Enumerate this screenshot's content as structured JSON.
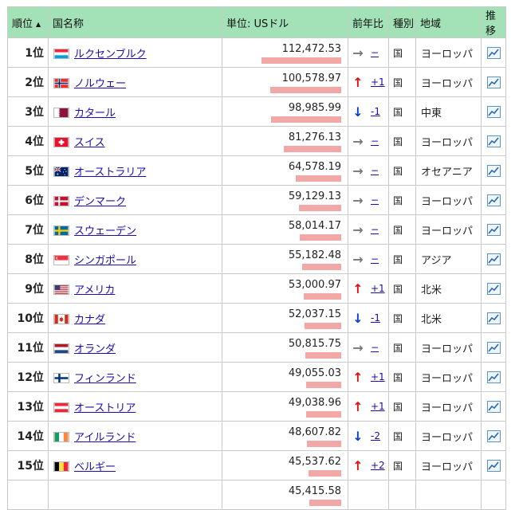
{
  "headers": {
    "rank": "順位",
    "sort_marker": "▲",
    "country": "国名称",
    "unit": "単位: USドル",
    "change": "前年比",
    "type": "種別",
    "region": "地域",
    "trend": "推移"
  },
  "rows": [
    {
      "rank": "1位",
      "country": "ルクセンブルク",
      "flag": "luxembourg",
      "value": "112,472.53",
      "bar": 1.0,
      "dir": "same",
      "arrow": "→",
      "change": "−",
      "type": "国",
      "region": "ヨーロッパ"
    },
    {
      "rank": "2位",
      "country": "ノルウェー",
      "flag": "norway",
      "value": "100,578.97",
      "bar": 0.894,
      "dir": "up",
      "arrow": "↑",
      "change": "+1",
      "type": "国",
      "region": "ヨーロッパ"
    },
    {
      "rank": "3位",
      "country": "カタール",
      "flag": "qatar",
      "value": "98,985.99",
      "bar": 0.88,
      "dir": "down",
      "arrow": "↓",
      "change": "-1",
      "type": "国",
      "region": "中東"
    },
    {
      "rank": "4位",
      "country": "スイス",
      "flag": "switzerland",
      "value": "81,276.13",
      "bar": 0.723,
      "dir": "same",
      "arrow": "→",
      "change": "−",
      "type": "国",
      "region": "ヨーロッパ"
    },
    {
      "rank": "5位",
      "country": "オーストラリア",
      "flag": "australia",
      "value": "64,578.19",
      "bar": 0.574,
      "dir": "same",
      "arrow": "→",
      "change": "−",
      "type": "国",
      "region": "オセアニア"
    },
    {
      "rank": "6位",
      "country": "デンマーク",
      "flag": "denmark",
      "value": "59,129.13",
      "bar": 0.526,
      "dir": "same",
      "arrow": "→",
      "change": "−",
      "type": "国",
      "region": "ヨーロッパ"
    },
    {
      "rank": "7位",
      "country": "スウェーデン",
      "flag": "sweden",
      "value": "58,014.17",
      "bar": 0.516,
      "dir": "same",
      "arrow": "→",
      "change": "−",
      "type": "国",
      "region": "ヨーロッパ"
    },
    {
      "rank": "8位",
      "country": "シンガポール",
      "flag": "singapore",
      "value": "55,182.48",
      "bar": 0.491,
      "dir": "same",
      "arrow": "→",
      "change": "−",
      "type": "国",
      "region": "アジア"
    },
    {
      "rank": "9位",
      "country": "アメリカ",
      "flag": "usa",
      "value": "53,000.97",
      "bar": 0.471,
      "dir": "up",
      "arrow": "↑",
      "change": "+1",
      "type": "国",
      "region": "北米"
    },
    {
      "rank": "10位",
      "country": "カナダ",
      "flag": "canada",
      "value": "52,037.15",
      "bar": 0.463,
      "dir": "down",
      "arrow": "↓",
      "change": "-1",
      "type": "国",
      "region": "北米"
    },
    {
      "rank": "11位",
      "country": "オランダ",
      "flag": "netherlands",
      "value": "50,815.75",
      "bar": 0.452,
      "dir": "same",
      "arrow": "→",
      "change": "−",
      "type": "国",
      "region": "ヨーロッパ"
    },
    {
      "rank": "12位",
      "country": "フィンランド",
      "flag": "finland",
      "value": "49,055.03",
      "bar": 0.436,
      "dir": "up",
      "arrow": "↑",
      "change": "+1",
      "type": "国",
      "region": "ヨーロッパ"
    },
    {
      "rank": "13位",
      "country": "オーストリア",
      "flag": "austria",
      "value": "49,038.96",
      "bar": 0.436,
      "dir": "up",
      "arrow": "↑",
      "change": "+1",
      "type": "国",
      "region": "ヨーロッパ"
    },
    {
      "rank": "14位",
      "country": "アイルランド",
      "flag": "ireland",
      "value": "48,607.82",
      "bar": 0.432,
      "dir": "down",
      "arrow": "↓",
      "change": "-2",
      "type": "国",
      "region": "ヨーロッパ"
    },
    {
      "rank": "15位",
      "country": "ベルギー",
      "flag": "belgium",
      "value": "45,537.62",
      "bar": 0.405,
      "dir": "up",
      "arrow": "↑",
      "change": "+2",
      "type": "国",
      "region": "ヨーロッパ"
    },
    {
      "rank": "",
      "country": "",
      "flag": "",
      "value": "45,415.58",
      "bar": 0.404,
      "dir": "",
      "arrow": "",
      "change": "",
      "type": "",
      "region": ""
    }
  ],
  "colors": {
    "header_bg": "#a3e2b6",
    "bar": "#f3a8a8",
    "up": "#e01010",
    "down": "#0a3ed8",
    "same": "#777777",
    "link": "#1a0dab"
  },
  "icons": {
    "trend": "line-chart-icon",
    "sort": "sort-ascending-icon"
  }
}
